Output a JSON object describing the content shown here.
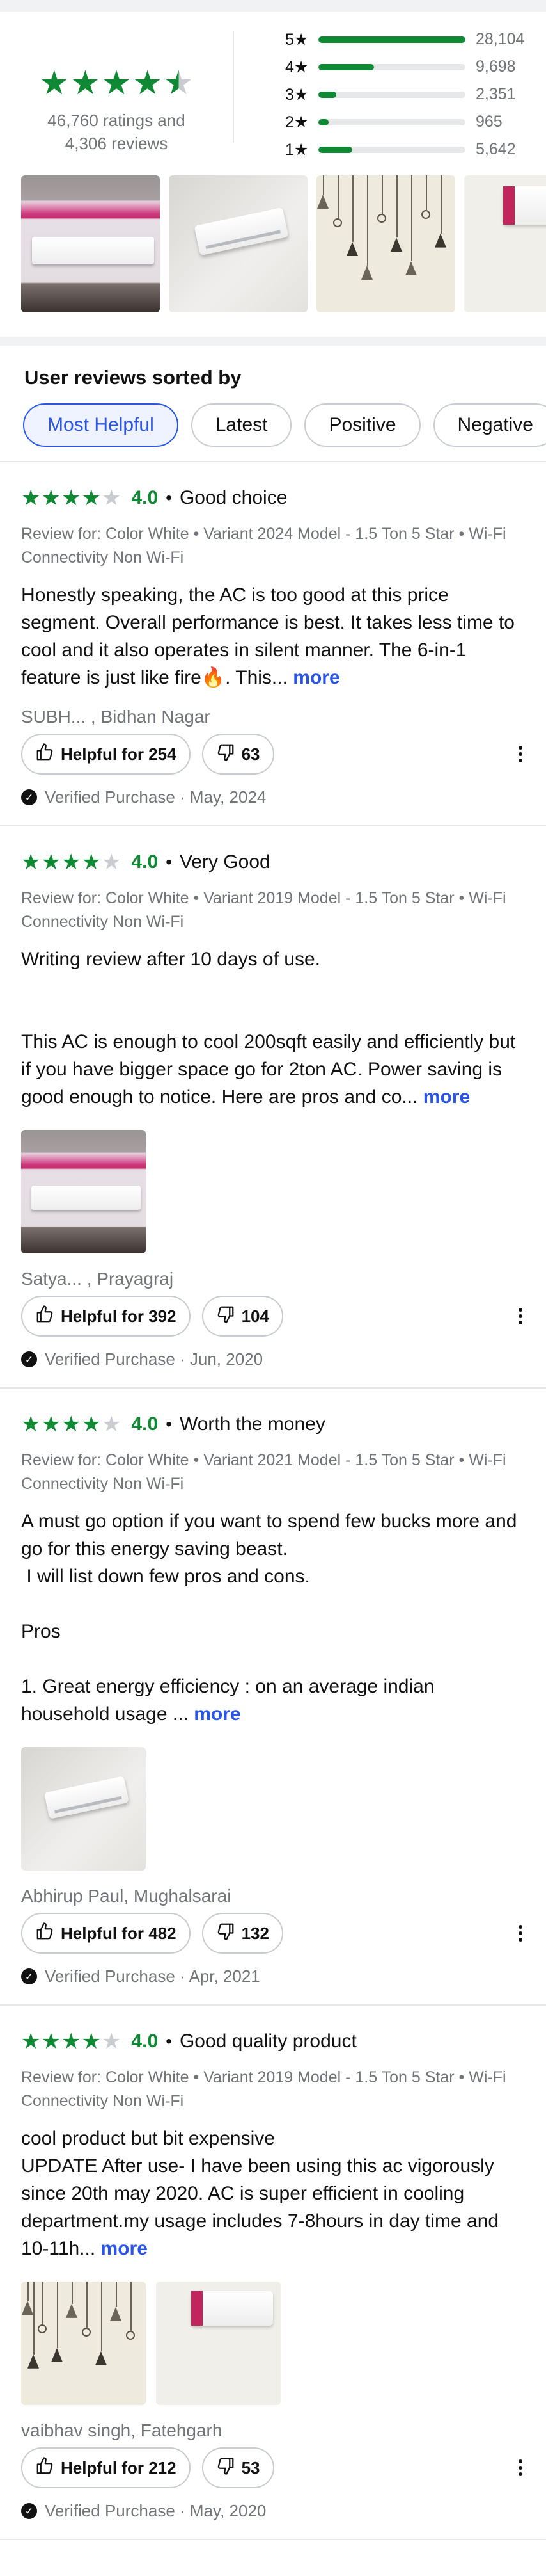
{
  "summary": {
    "overall_stars": 4.5,
    "ratings_line": "46,760 ratings and",
    "reviews_line": "4,306 reviews",
    "breakdown": [
      {
        "label": "5★",
        "count": "28,104",
        "fraction": 1.0
      },
      {
        "label": "4★",
        "count": "9,698",
        "fraction": 0.38
      },
      {
        "label": "3★",
        "count": "2,351",
        "fraction": 0.12
      },
      {
        "label": "2★",
        "count": "965",
        "fraction": 0.07
      },
      {
        "label": "1★",
        "count": "5,642",
        "fraction": 0.23
      }
    ]
  },
  "sort": {
    "title": "User reviews sorted by",
    "chips": [
      {
        "label": "Most Helpful",
        "active": true
      },
      {
        "label": "Latest",
        "active": false
      },
      {
        "label": "Positive",
        "active": false
      },
      {
        "label": "Negative",
        "active": false
      }
    ]
  },
  "reviews": [
    {
      "stars": 4,
      "rating": "4.0",
      "dot": "•",
      "title": "Good choice",
      "meta": "Review for: Color White • Variant 2024 Model  -  1.5 Ton 5 Star • Wi-Fi Connectivity Non Wi-Fi",
      "body": "Honestly speaking, the AC is too good at this price segment. Overall performance is best. It takes less time to cool and it also operates in silent manner. The 6-in-1 feature is just like fire🔥. This...",
      "more": "more",
      "photos": [],
      "author": "SUBH... , Bidhan Nagar",
      "helpful": "Helpful for 254",
      "dislikes": "63",
      "verified": "Verified Purchase · May, 2024"
    },
    {
      "stars": 4,
      "rating": "4.0",
      "dot": "•",
      "title": "Very Good",
      "meta": "Review for: Color White • Variant 2019 Model  -  1.5 Ton 5 Star • Wi-Fi Connectivity Non Wi-Fi",
      "body": "Writing review after 10 days of use.\n\n\nThis AC is enough to cool 200sqft easily and efficiently but if you have bigger space go for 2ton AC. Power saving is good enough to notice. Here are pros and co...",
      "more": "more",
      "photos": [
        "wall-pink"
      ],
      "author": "Satya... , Prayagraj",
      "helpful": "Helpful for 392",
      "dislikes": "104",
      "verified": "Verified Purchase · Jun, 2020"
    },
    {
      "stars": 4,
      "rating": "4.0",
      "dot": "•",
      "title": "Worth the money",
      "meta": "Review for: Color White • Variant 2021 Model  -  1.5 Ton 5 Star • Wi-Fi Connectivity Non Wi-Fi",
      "body": "A must go option if you want to spend few bucks more and go for this energy saving beast.\n I will list down few pros and cons.\n\nPros\n\n1. Great energy efficiency : on an average indian household usage ...",
      "more": "more",
      "photos": [
        "ac-angle"
      ],
      "author": "Abhirup Paul, Mughalsarai",
      "helpful": "Helpful for 482",
      "dislikes": "132",
      "verified": "Verified Purchase · Apr, 2021"
    },
    {
      "stars": 4,
      "rating": "4.0",
      "dot": "•",
      "title": "Good quality product",
      "meta": "Review for: Color White • Variant 2019 Model  -  1.5 Ton 5 Star • Wi-Fi Connectivity Non Wi-Fi",
      "body": "cool product but bit expensive\nUPDATE After use- I have been using this ac vigorously since 20th may 2020. AC is super efficient in cooling department.my usage includes 7-8hours in day time and 10-11h...",
      "more": "more",
      "photos": [
        "deco",
        "deco2"
      ],
      "author": "vaibhav singh, Fatehgarh",
      "helpful": "Helpful for 212",
      "dislikes": "53",
      "verified": "Verified Purchase · May, 2020"
    }
  ],
  "icons": {
    "star": "star-icon",
    "thumbs_up": "thumbs-up-icon",
    "thumbs_down": "thumbs-down-icon",
    "check": "check-circle-icon",
    "kebab": "more-options-icon"
  },
  "colors": {
    "green": "#108934",
    "blue": "#2a55e5",
    "grey": "#717478"
  }
}
